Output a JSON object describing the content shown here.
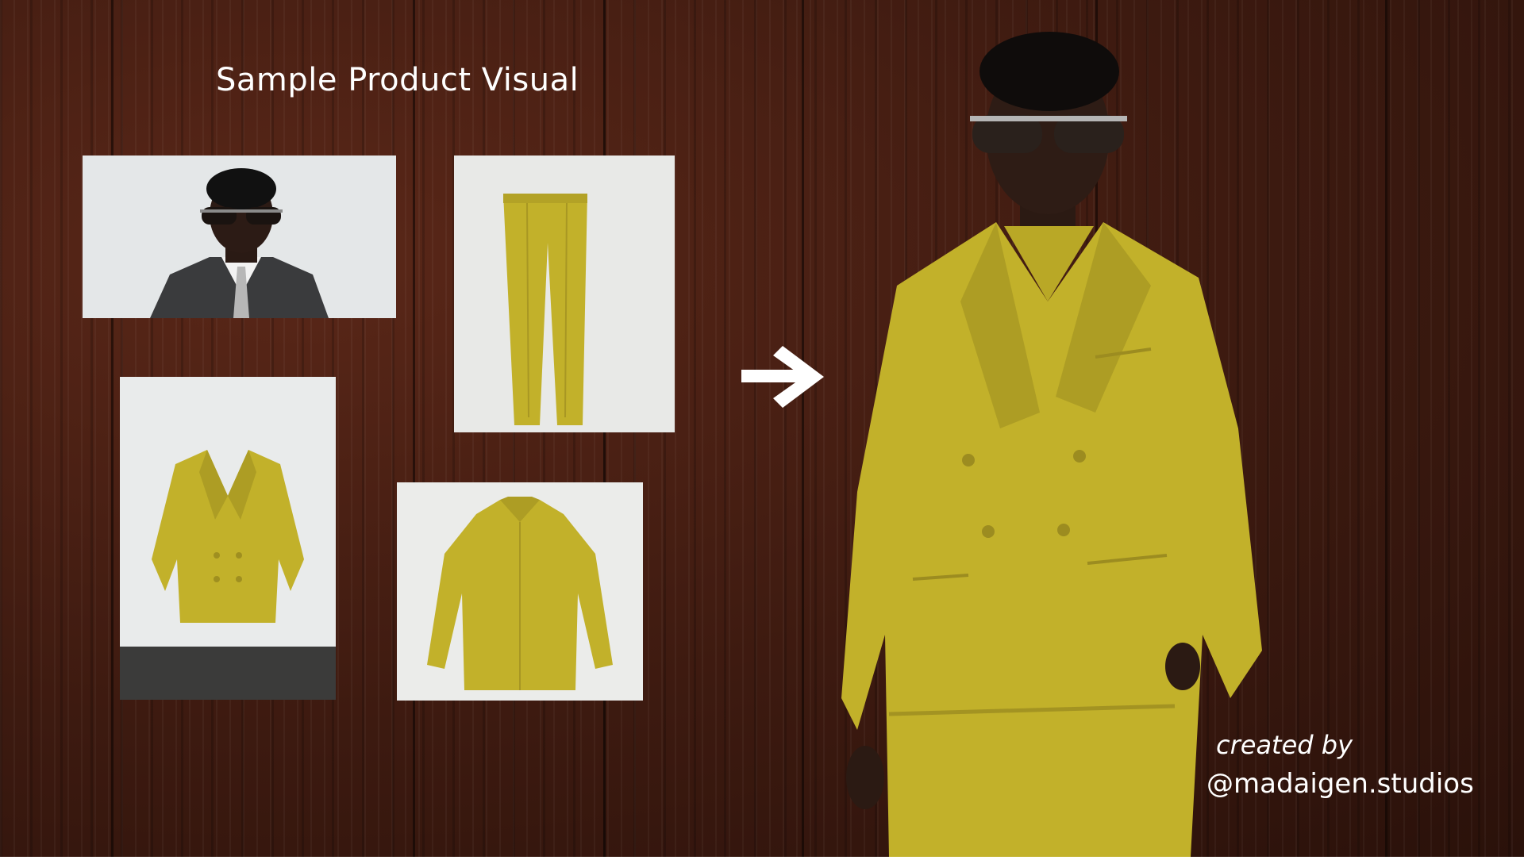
{
  "title": "Sample Product Visual",
  "credit": {
    "line1": "created by",
    "line2": "@madaigen.studios"
  },
  "images": {
    "portrait": "model-portrait-photo",
    "trousers": "yellow-trousers-photo",
    "blazer": "yellow-blazer-photo",
    "shirt": "yellow-shirt-photo",
    "result": "model-in-yellow-suit-photo"
  },
  "colors": {
    "background_wood": "#3d1a10",
    "garment_yellow": "#c2b12a",
    "text": "#ffffff",
    "photo_backdrop": "#e6e8e8"
  },
  "icons": {
    "transform_arrow": "arrow-right-icon"
  }
}
